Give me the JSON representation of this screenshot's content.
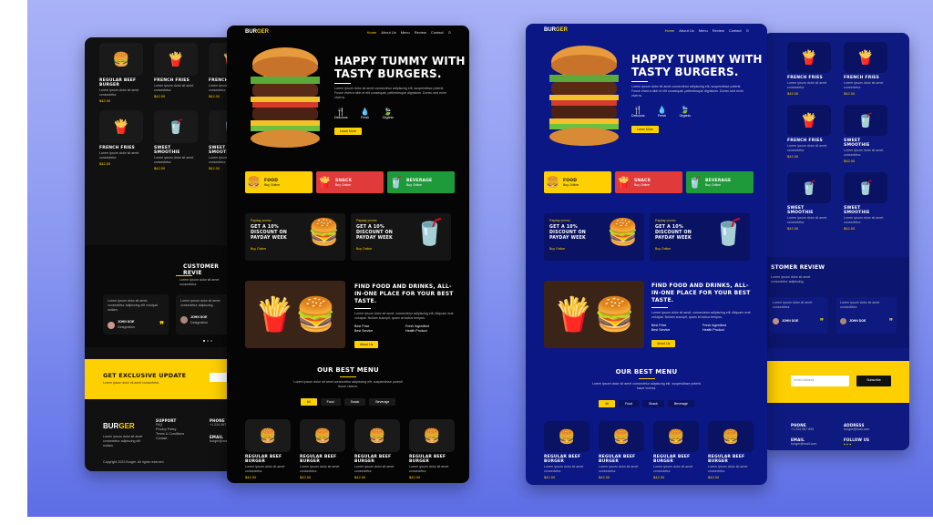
{
  "brand": {
    "logo_a": "BUR",
    "logo_b": "GER"
  },
  "nav": [
    "Home",
    "About Us",
    "Menu",
    "Review",
    "Contact"
  ],
  "hero": {
    "title_1": "HAPPY TUMMY WITH",
    "title_2": "TASTY BURGERS.",
    "text": "Lorem ipsum dolor sit amet consectetur adipiscing elit, suspendisse potenti. Fusce viverra nibh et elit consequat, pellentesque dignissim. Donec sed enim viverra.",
    "features": [
      "Delicious",
      "Fresh",
      "Organic"
    ],
    "cta": "Learn More"
  },
  "categories": [
    {
      "label": "FOOD",
      "link": "Buy Online",
      "color": "#ffd000"
    },
    {
      "label": "SNACK",
      "link": "Buy Online",
      "color": "#e03a3a"
    },
    {
      "label": "BEVERAGE",
      "link": "Buy Online",
      "color": "#1f9a3a"
    }
  ],
  "promos": [
    {
      "kicker": "Payday promo",
      "title": "GET A 10% DISCOUNT ON PAYDAY WEEK",
      "link": "Buy Online"
    },
    {
      "kicker": "Payday promo",
      "title": "GET A 10% DISCOUNT ON PAYDAY WEEK",
      "link": "Buy Online"
    }
  ],
  "about": {
    "title": "FIND FOOD AND DRINKS, ALL-IN-ONE PLACE FOR YOUR BEST TASTE.",
    "text": "Lorem ipsum dolor sit amet, consectetur adipiscing elit. Aliquam erat volutpat. Nullam suscipit, quam at luctus tempus.",
    "bullets": [
      "Best Price",
      "Best Service",
      "Fresh Ingredient",
      "Health Product"
    ],
    "cta": "About Us"
  },
  "menu": {
    "title": "OUR BEST MENU",
    "text": "Lorem ipsum dolor sit amet consectetur adipiscing elit, suspendisse potenti fusce viverra.",
    "tabs": [
      "All",
      "Food",
      "Snack",
      "Beverage"
    ]
  },
  "products_main": [
    {
      "name": "REGULAR BEEF BURGER",
      "price": "$42.00"
    },
    {
      "name": "REGULAR BEEF BURGER",
      "price": "$42.00"
    },
    {
      "name": "REGULAR BEEF BURGER",
      "price": "$42.00"
    },
    {
      "name": "REGULAR BEEF BURGER",
      "price": "$42.00"
    }
  ],
  "products_back": [
    {
      "name": "REGULAR BEEF BURGER",
      "price": "$42.00"
    },
    {
      "name": "FRENCH FRIES",
      "price": "$42.00"
    },
    {
      "name": "FRENCH FRIES",
      "price": "$42.00"
    },
    {
      "name": "FRENCH FRIES",
      "price": "$42.00"
    },
    {
      "name": "SWEET SMOOTHIE",
      "price": "$42.00"
    },
    {
      "name": "SWEET SMOOTHIE",
      "price": "$42.00"
    }
  ],
  "products_back_blue": [
    {
      "name": "FRENCH FRIES",
      "price": "$42.00"
    },
    {
      "name": "FRENCH FRIES",
      "price": "$42.00"
    },
    {
      "name": "FRENCH FRIES",
      "price": "$42.00"
    },
    {
      "name": "SWEET SMOOTHIE",
      "price": "$42.00"
    },
    {
      "name": "SWEET SMOOTHIE",
      "price": "$42.00"
    },
    {
      "name": "SWEET SMOOTHIE",
      "price": "$42.00"
    }
  ],
  "reviews": {
    "title": "CUSTOMER REVIEW",
    "title_short": "CUSTOMER REVIE",
    "title_blue": "STOMER REVIEW",
    "people": [
      {
        "name": "JOHN DOE",
        "role": "Designation"
      },
      {
        "name": "JOHN DOE",
        "role": "Designation"
      }
    ]
  },
  "newsletter": {
    "title": "GET EXCLUSIVE UPDATE",
    "placeholder": "Email Address",
    "button": "Subscribe"
  },
  "footer": {
    "support": "SUPPORT",
    "support_links": [
      "FAQ",
      "Privacy Policy",
      "Terms & Conditions",
      "Contact"
    ],
    "phone": "PHONE",
    "phone_val": "+1 234 567 890",
    "email": "EMAIL",
    "email_val": "burger@mail.com",
    "address": "ADDRESS",
    "follow": "FOLLOW US",
    "copyright": "Copyright 2023 Burger. All rights reserved."
  },
  "colors": {
    "accent": "#ffd000",
    "dark_bg": "#050505",
    "blue_bg": "#0b1784"
  }
}
